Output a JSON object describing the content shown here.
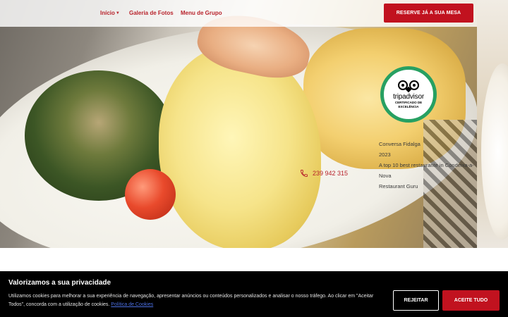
{
  "nav": {
    "home_label": "Início",
    "gallery_label": "Galeria de Fotos",
    "menu_label": "Menu de Grupo",
    "reserve_label": "RESERVE JÁ A SUA MESA",
    "accent_color": "#c1121f"
  },
  "tripadvisor": {
    "brand": "tripadvisor",
    "line1": "CERTIFICADO DE",
    "line2": "EXCELÊNCIA",
    "badge_color": "#27a062"
  },
  "award": {
    "line1": "Conversa Fidalga",
    "line2": "2023",
    "line3": "A top 10 best restaurante in Condeixa-a-Nova",
    "line4": "Restaurant Guru"
  },
  "contact": {
    "phone": "239 942 315",
    "icon": "phone-icon"
  },
  "cookie_banner": {
    "title": "Valorizamos a sua privacidade",
    "text": "Utilizamos cookies para melhorar a sua experiência de navegação, apresentar anúncios ou conteúdos personalizados e analisar o nosso tráfego. Ao clicar em \"Aceitar Todos\", concorda com a utilização de cookies.",
    "link_label": "Política de Cookies",
    "reject_label": "REJEITAR",
    "accept_label": "ACEITE TUDO"
  }
}
